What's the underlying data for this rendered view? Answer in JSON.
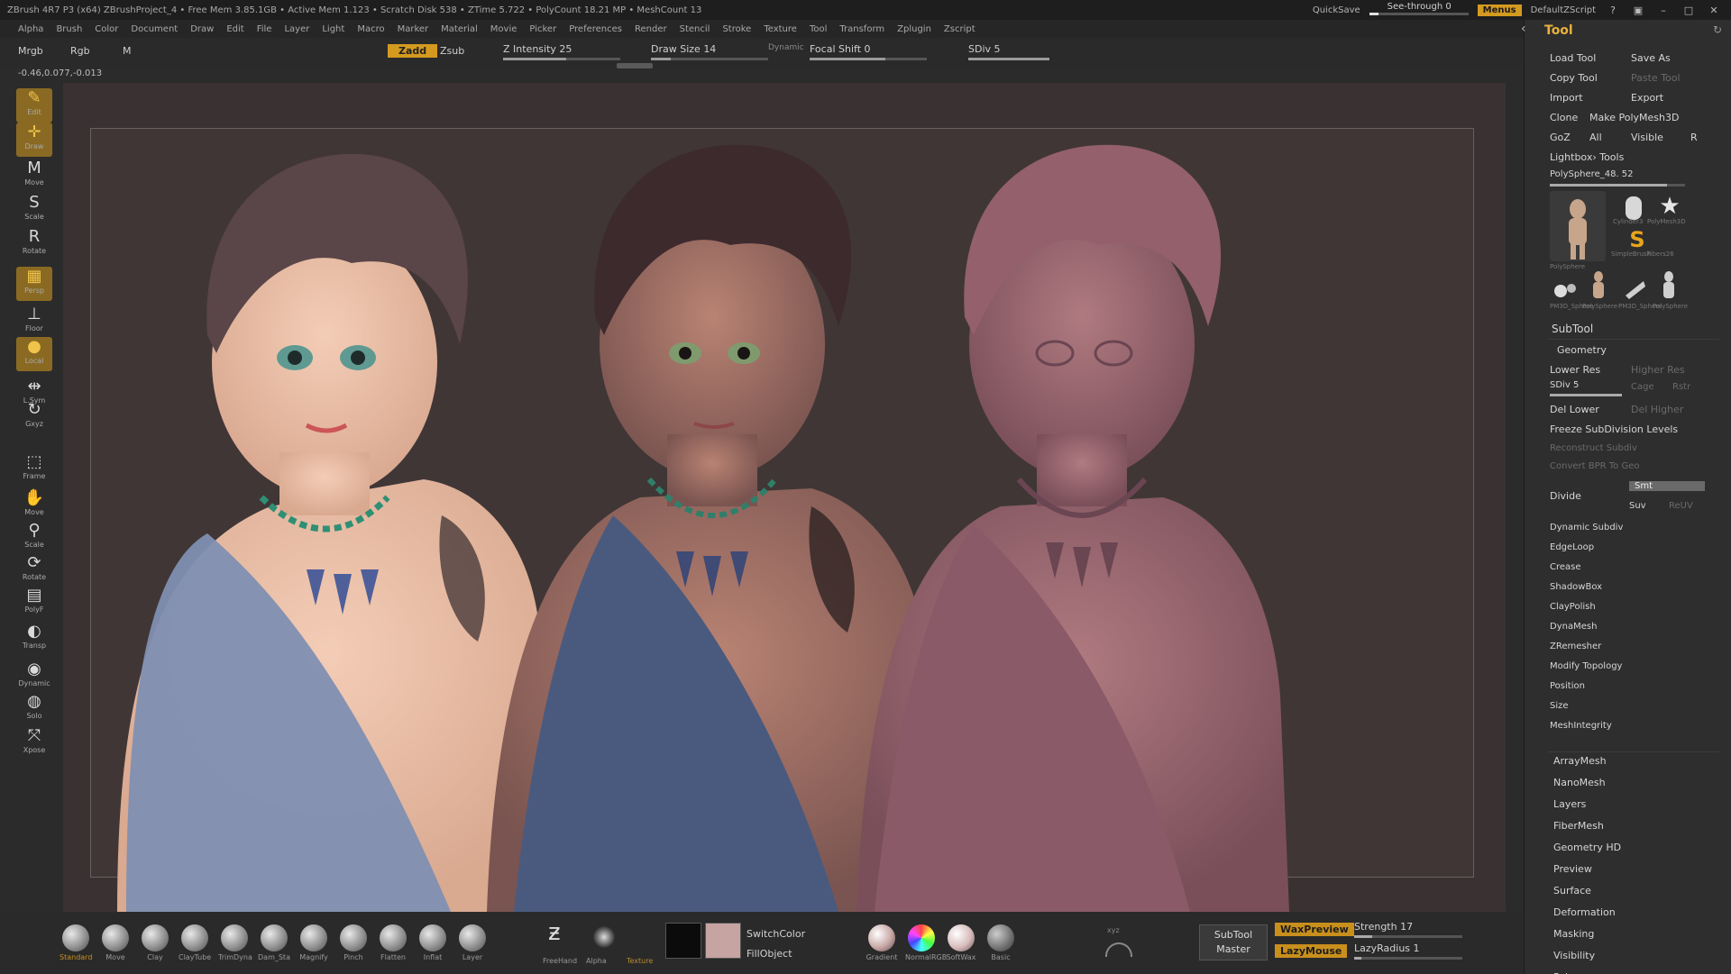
{
  "titlebar": {
    "title": "ZBrush 4R7 P3 (x64)   ZBrushProject_4   • Free Mem 3.85.1GB • Active Mem 1.123 • Scratch Disk 538 • ZTime 5.722 • PolyCount 18.21 MP • MeshCount 13",
    "quicksave": "QuickSave",
    "see_through": "See-through",
    "see_through_value": "0",
    "menus": "Menus",
    "script": "DefaultZScript"
  },
  "menubar": {
    "items": [
      "Alpha",
      "Brush",
      "Color",
      "Document",
      "Draw",
      "Edit",
      "File",
      "Layer",
      "Light",
      "Macro",
      "Marker",
      "Material",
      "Movie",
      "Picker",
      "Preferences",
      "Render",
      "Stencil",
      "Stroke",
      "Texture",
      "Tool",
      "Transform",
      "Zplugin",
      "Zscript"
    ]
  },
  "toptool": {
    "mrgb": "Mrgb",
    "rgb": "Rgb",
    "m": "M",
    "zadd": "Zadd",
    "zsub": "Zsub",
    "z_intensity_label": "Z Intensity",
    "z_intensity": "25",
    "draw_size_label": "Draw Size",
    "draw_size": "14",
    "dynamic": "Dynamic",
    "focal_shift_label": "Focal Shift",
    "focal_shift": "0",
    "sdiv_label": "SDiv",
    "sdiv": "5",
    "coords": "-0.46,0.077,-0.013"
  },
  "leftshelf": {
    "items": [
      {
        "label": "Edit",
        "icon": "✎"
      },
      {
        "label": "Draw",
        "icon": "✛"
      },
      {
        "label": "Move",
        "icon": "M"
      },
      {
        "label": "Scale",
        "icon": "S"
      },
      {
        "label": "Rotate",
        "icon": "R"
      },
      {
        "label": "Persp",
        "icon": "▦"
      },
      {
        "label": "Floor",
        "icon": "⊥"
      },
      {
        "label": "Local",
        "icon": "●"
      },
      {
        "label": "L.Sym",
        "icon": "⇹"
      },
      {
        "label": "Gxyz",
        "icon": "↻"
      },
      {
        "label": "Frame",
        "icon": "⬚"
      },
      {
        "label": "Move",
        "icon": "✋"
      },
      {
        "label": "Scale",
        "icon": "⚲"
      },
      {
        "label": "Rotate",
        "icon": "⟳"
      },
      {
        "label": "PolyF",
        "icon": "▤"
      },
      {
        "label": "Transp",
        "icon": "◐"
      },
      {
        "label": "Dynamic",
        "icon": "◉"
      },
      {
        "label": "Solo",
        "icon": "◍"
      },
      {
        "label": "Xpose",
        "icon": "⤧"
      }
    ]
  },
  "toolpanel": {
    "title": "Tool",
    "load_tool": "Load Tool",
    "save_as": "Save As",
    "copy_tool": "Copy Tool",
    "paste_tool": "Paste Tool",
    "import": "Import",
    "export": "Export",
    "clone": "Clone",
    "make_polymesh": "Make PolyMesh3D",
    "goz": "GoZ",
    "all": "All",
    "visible": "Visible",
    "r": "R",
    "lightbox_tools": "Lightbox› Tools",
    "current_tool": "PolySphere_48. 52",
    "thumb_labels": [
      "PolySphere",
      "Cylinder3",
      "PolyMesh3D",
      "SimpleBrush",
      "Fibers26",
      "PM3D_Sphere",
      "PolySphere",
      "PM3D_Sphere",
      "PolySphere"
    ],
    "subtool": "SubTool",
    "geometry": "Geometry",
    "lower_res": "Lower Res",
    "higher_res": "Higher Res",
    "sdiv_label": "SDiv",
    "sdiv_value": "5",
    "cage": "Cage",
    "rstr": "Rstr",
    "del_lower": "Del Lower",
    "del_higher": "Del Higher",
    "freeze": "Freeze SubDivision Levels",
    "reconstruct": "Reconstruct Subdiv",
    "convert": "Convert BPR To Geo",
    "divide": "Divide",
    "smt": "Smt",
    "suv": "Suv",
    "reuv": "ReUV",
    "geometry_items": [
      "Dynamic Subdiv",
      "EdgeLoop",
      "Crease",
      "ShadowBox",
      "ClayPolish",
      "DynaMesh",
      "ZRemesher",
      "Modify Topology",
      "Position",
      "Size",
      "MeshIntegrity"
    ],
    "sections": [
      "ArrayMesh",
      "NanoMesh",
      "Layers",
      "FiberMesh",
      "Geometry HD",
      "Preview",
      "Surface",
      "Deformation",
      "Masking",
      "Visibility",
      "Polygroups"
    ]
  },
  "bottomshelf": {
    "brushes": [
      "Standard",
      "Move",
      "Clay",
      "ClayTube",
      "TrimDyna",
      "Dam_Sta",
      "Magnify",
      "Pinch",
      "Flatten",
      "Inflat",
      "Layer"
    ],
    "freehand": "FreeHand",
    "alpha": "Alpha",
    "texture": "Texture",
    "switch_color": "SwitchColor",
    "fill_object": "FillObject",
    "materials": [
      "Gradient",
      "NormalRGB",
      "SoftWax",
      "Basic"
    ],
    "subtool_master_1": "SubTool",
    "subtool_master_2": "Master",
    "wax_preview": "WaxPreview",
    "lazy_mouse": "LazyMouse",
    "strength_label": "Strength",
    "strength": "17",
    "lazy_radius_label": "LazyRadius",
    "lazy_radius": "1",
    "xyz": "xyz"
  },
  "colors": {
    "accent": "#d49a1f",
    "panel": "#2e2e2e",
    "canvas": "#3a3232"
  }
}
